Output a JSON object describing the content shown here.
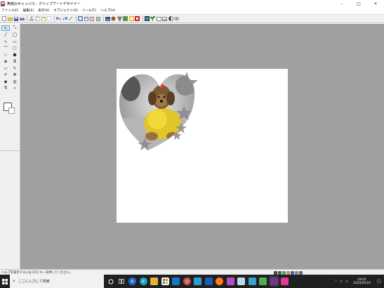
{
  "window": {
    "title": "無題のキャンバス - クリップアートデザイナー",
    "minimize_glyph": "–",
    "maximize_glyph": "□",
    "close_glyph": "×"
  },
  "menu": {
    "items": [
      {
        "label": "ファイル(F)"
      },
      {
        "label": "編集(E)"
      },
      {
        "label": "表示(V)"
      },
      {
        "label": "オブジェクト(O)"
      },
      {
        "label": "ツール(T)"
      },
      {
        "label": "ヘルプ(H)"
      }
    ]
  },
  "toolbar": {
    "groups": [
      [
        "new-file-icon",
        "open-folder-icon",
        "save-icon",
        "print-icon"
      ],
      [
        "cut-icon",
        "copy-icon",
        "paste-icon",
        "delete-icon"
      ],
      [
        "undo-icon",
        "redo-icon",
        "brush-icon"
      ],
      [
        "view-1-icon",
        "view-2-icon",
        "view-3-icon",
        "view-4-icon"
      ],
      [
        "insert-image-icon",
        "color-wheel-icon",
        "effects-icon",
        "texture-icon",
        "clipart-icon",
        "flag-icon"
      ],
      [
        "layer-icon",
        "plant-icon",
        "frame-icon",
        "picture-icon",
        "contrast-icon",
        "eye-icon"
      ]
    ]
  },
  "tools": [
    "select-arrow-icon",
    "transform-icon",
    "line-icon",
    "ellipse-icon",
    "freehand-icon",
    "rectangle-icon",
    "curve-icon",
    "rounded-rect-icon",
    "star-icon",
    "polygon-icon",
    "bucket-icon",
    "text-icon",
    "eraser-icon",
    "pencil-icon",
    "brush-tool-icon",
    "move-icon",
    "fill-icon",
    "blur-icon",
    "eyedropper-icon",
    "zoom-icon"
  ],
  "colors": {
    "workspace": "#a0a0a0",
    "canvas": "#ffffff",
    "taskbar": "#202020",
    "toolbar": "#f0f0f0"
  },
  "status": {
    "text": "ヘルプを表示するには [F1] キーを押してください。"
  },
  "taskbar": {
    "search_placeholder": "ここに入力して検索",
    "time": "18:01",
    "date": "2020/05/10",
    "app_icons": [
      "cortana-icon",
      "task-view-icon",
      "edge-icon",
      "edge-chromium-icon",
      "file-explorer-icon",
      "store-icon",
      "mail-icon",
      "chrome-icon",
      "app-icon-1",
      "app-icon-2",
      "firefox-icon",
      "app-icon-3",
      "app-icon-4",
      "app-icon-5",
      "app-icon-6",
      "clipart-designer-icon",
      "app-icon-7"
    ]
  }
}
